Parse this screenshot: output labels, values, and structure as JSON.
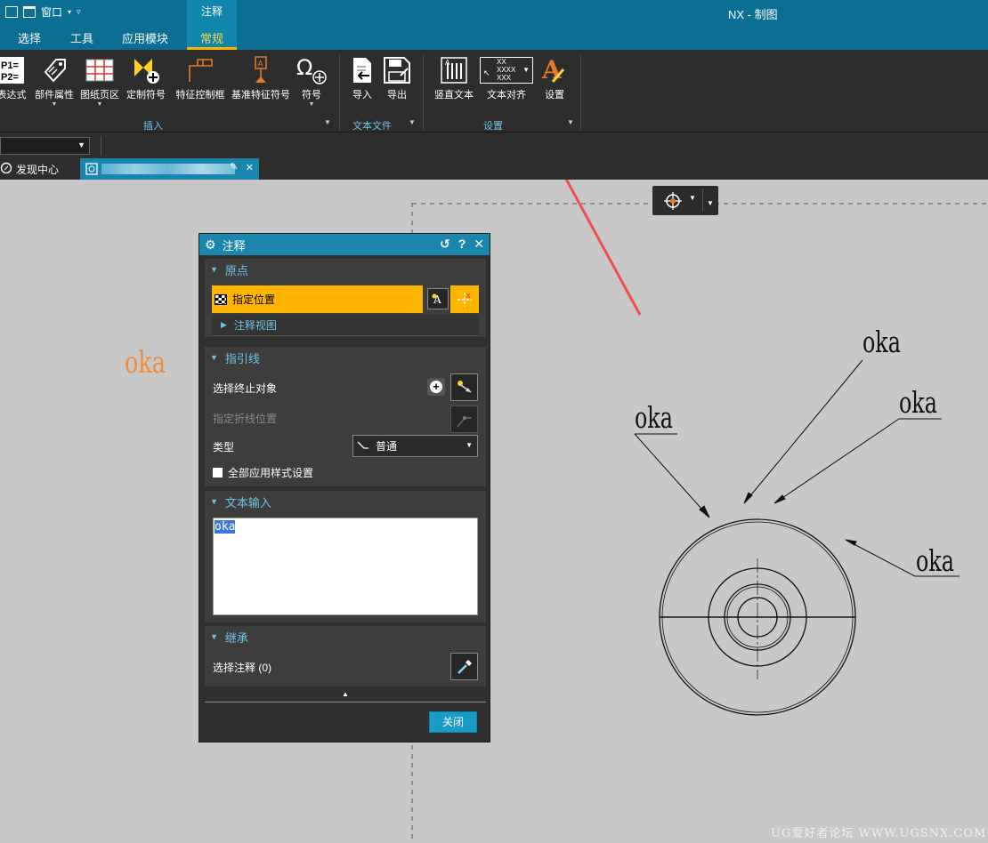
{
  "titlebar": {
    "window_menu": "窗口",
    "context_tab": "注释",
    "app_title": "NX - 制图"
  },
  "ribbon_tabs": [
    "选择",
    "工具",
    "应用模块",
    "常规"
  ],
  "ribbon": {
    "buttons": [
      "表达式",
      "部件属性",
      "图纸页区",
      "定制符号",
      "特征控制框",
      "基准特征符号",
      "符号",
      "导入",
      "导出",
      "竖直文本",
      "文本对齐",
      "设置"
    ],
    "groups": [
      "插入",
      "文本文件",
      "设置"
    ],
    "align_icon_text": [
      "XX",
      "XXXX",
      "XXX"
    ]
  },
  "doc_tabs": {
    "home": "发现中心"
  },
  "dialog": {
    "title": "注释",
    "origin": {
      "title": "原点",
      "specify_location": "指定位置",
      "annotation_view": "注释视图"
    },
    "leader": {
      "title": "指引线",
      "select_terminating_object": "选择终止对象",
      "specify_jog_location": "指定折线位置",
      "type_label": "类型",
      "type_value": "普通",
      "apply_all_styles": "全部应用样式设置"
    },
    "text_input": {
      "title": "文本输入",
      "value": "oka"
    },
    "inherit": {
      "title": "继承",
      "select_annotation": "选择注释 (0)"
    },
    "close_button": "关闭"
  },
  "drawing": {
    "floating_text": "oka",
    "labels": [
      "oka",
      "oka",
      "oka",
      "oka"
    ]
  },
  "watermark": "UG爱好者论坛 WWW.UGSNX.COM",
  "colors": {
    "titlebar": "#0b6f93",
    "ribbon": "#2d2d2d",
    "accent_orange": "#ffb400",
    "dialog_header": "#1a86ad",
    "arrow": "#f0504c",
    "floating_text": "#f08a3c"
  }
}
